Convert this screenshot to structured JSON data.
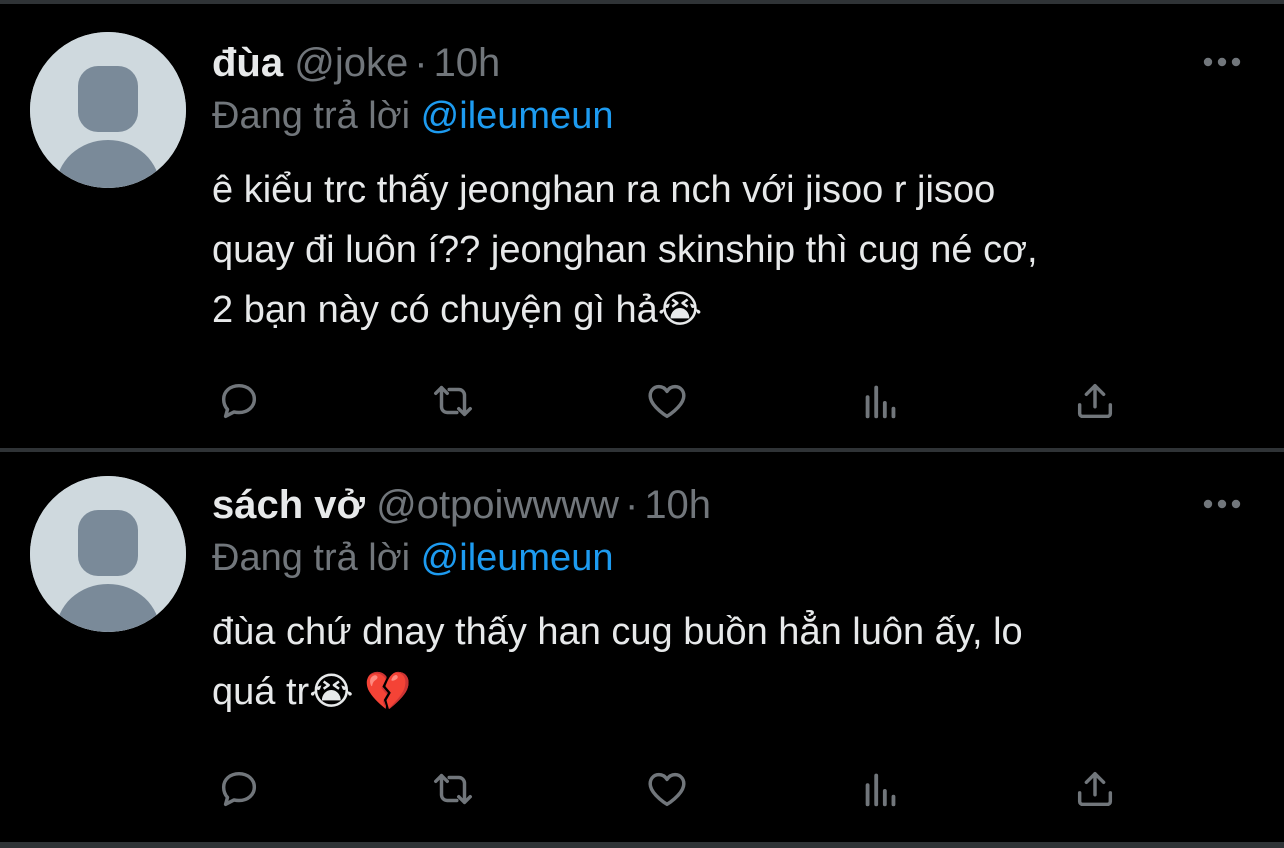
{
  "tweets": [
    {
      "name": "đùa",
      "handle": "@joke",
      "separator": "·",
      "time": "10h",
      "reply_prefix": "Đang trả lời",
      "reply_mention": "@ileumeun",
      "body_lines": [
        "ê kiểu trc thấy jeonghan ra nch với jisoo r jisoo",
        "quay đi luôn í?? jeonghan skinship thì cug né cơ,",
        "2 bạn này có chuyện gì hả😭"
      ]
    },
    {
      "name": "sách vở",
      "handle": "@otpoiwwww",
      "separator": "·",
      "time": "10h",
      "reply_prefix": "Đang trả lời",
      "reply_mention": "@ileumeun",
      "body_lines": [
        "đùa chứ dnay thấy han cug buồn hẳn luôn ấy, lo",
        "quá tr😭 💔"
      ]
    }
  ],
  "icons": {
    "reply": "reply-icon",
    "retweet": "retweet-icon",
    "like": "heart-icon",
    "views": "analytics-icon",
    "share": "share-icon",
    "more": "more-icon"
  },
  "colors": {
    "background": "#000000",
    "text": "#e7e9ea",
    "muted": "#71767b",
    "accent": "#1d9bf0",
    "divider": "#2f3336",
    "avatar_bg": "#cfd9de",
    "avatar_fg": "#7a8a99"
  }
}
